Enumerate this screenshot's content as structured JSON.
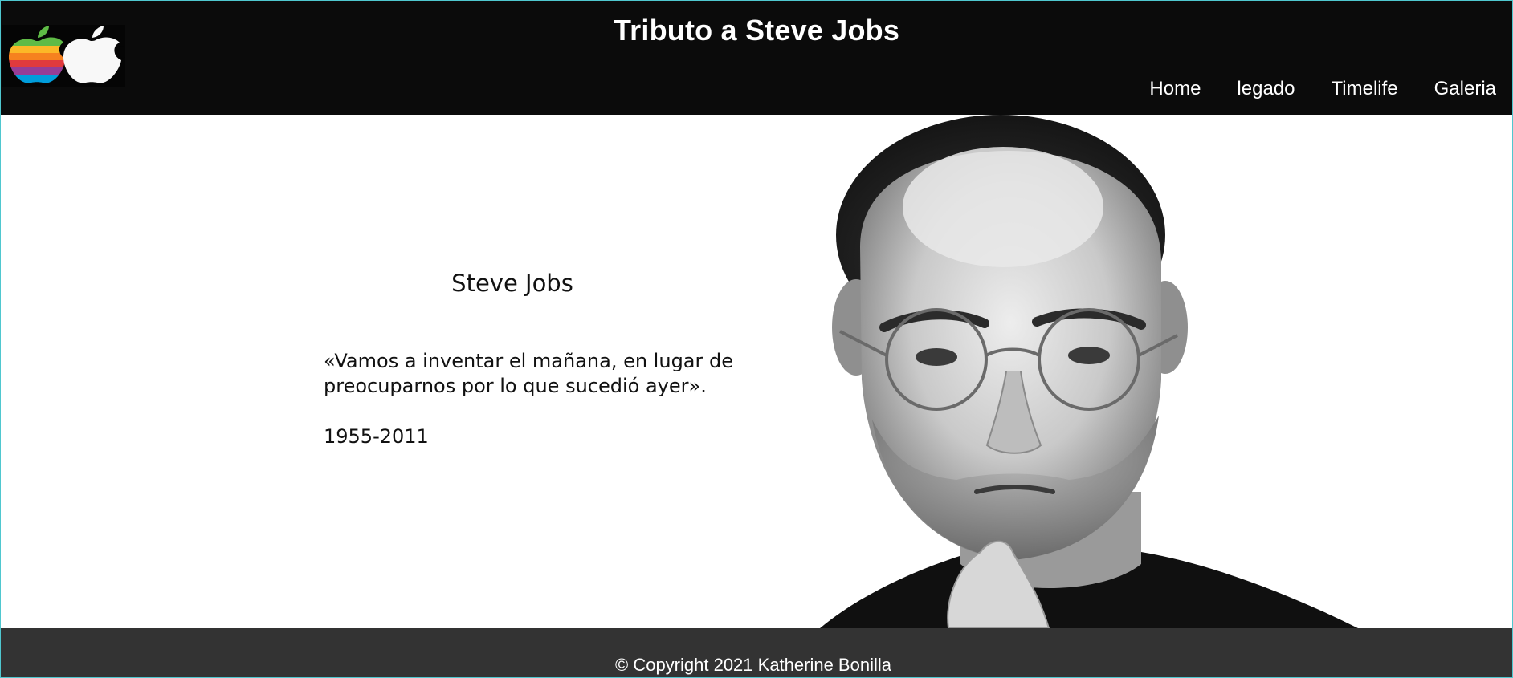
{
  "header": {
    "title": "Tributo a Steve Jobs",
    "logo_icon": "apple-logo-icon",
    "nav": [
      {
        "label": "Home"
      },
      {
        "label": "legado"
      },
      {
        "label": "Timelife"
      },
      {
        "label": "Galeria"
      }
    ]
  },
  "hero": {
    "name": "Steve Jobs",
    "quote": "«Vamos a inventar el mañana, en lugar de preocuparnos por lo que sucedió ayer».",
    "years": "1955-2011",
    "portrait_icon": "portrait-photo"
  },
  "footer": {
    "copyright": "© Copyright 2021 Katherine Bonilla"
  },
  "colors": {
    "header_bg": "#0b0b0b",
    "footer_bg": "#333333",
    "frame_border": "#4fc7cf",
    "text_light": "#ffffff",
    "text_dark": "#111111"
  }
}
